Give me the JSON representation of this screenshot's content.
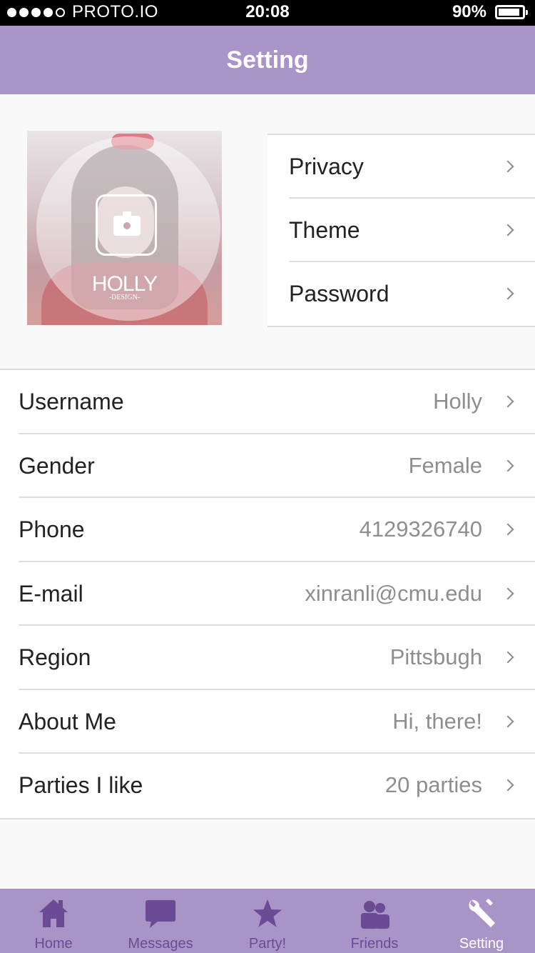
{
  "status_bar": {
    "carrier": "PROTO.IO",
    "time": "20:08",
    "battery": "90%",
    "battery_level": 0.9
  },
  "header": {
    "title": "Setting"
  },
  "profile": {
    "logo_text": "HOLLY",
    "logo_sub": "-DESIGN-"
  },
  "quick_settings": [
    {
      "label": "Privacy"
    },
    {
      "label": "Theme"
    },
    {
      "label": "Password"
    }
  ],
  "info": [
    {
      "label": "Username",
      "value": "Holly"
    },
    {
      "label": "Gender",
      "value": "Female"
    },
    {
      "label": "Phone",
      "value": "4129326740"
    },
    {
      "label": "E-mail",
      "value": "xinranli@cmu.edu"
    },
    {
      "label": "Region",
      "value": "Pittsbugh"
    },
    {
      "label": "About Me",
      "value": "Hi, there!"
    },
    {
      "label": "Parties I like",
      "value": "20 parties"
    }
  ],
  "tabs": [
    {
      "label": "Home",
      "icon": "home-icon"
    },
    {
      "label": "Messages",
      "icon": "chat-bubble-icon"
    },
    {
      "label": "Party!",
      "icon": "star-icon"
    },
    {
      "label": "Friends",
      "icon": "people-icon"
    },
    {
      "label": "Setting",
      "icon": "wrench-icon",
      "active": true
    }
  ],
  "colors": {
    "accent": "#a994c7",
    "tab_inactive": "#6b4b93",
    "tab_active": "#ffffff"
  }
}
